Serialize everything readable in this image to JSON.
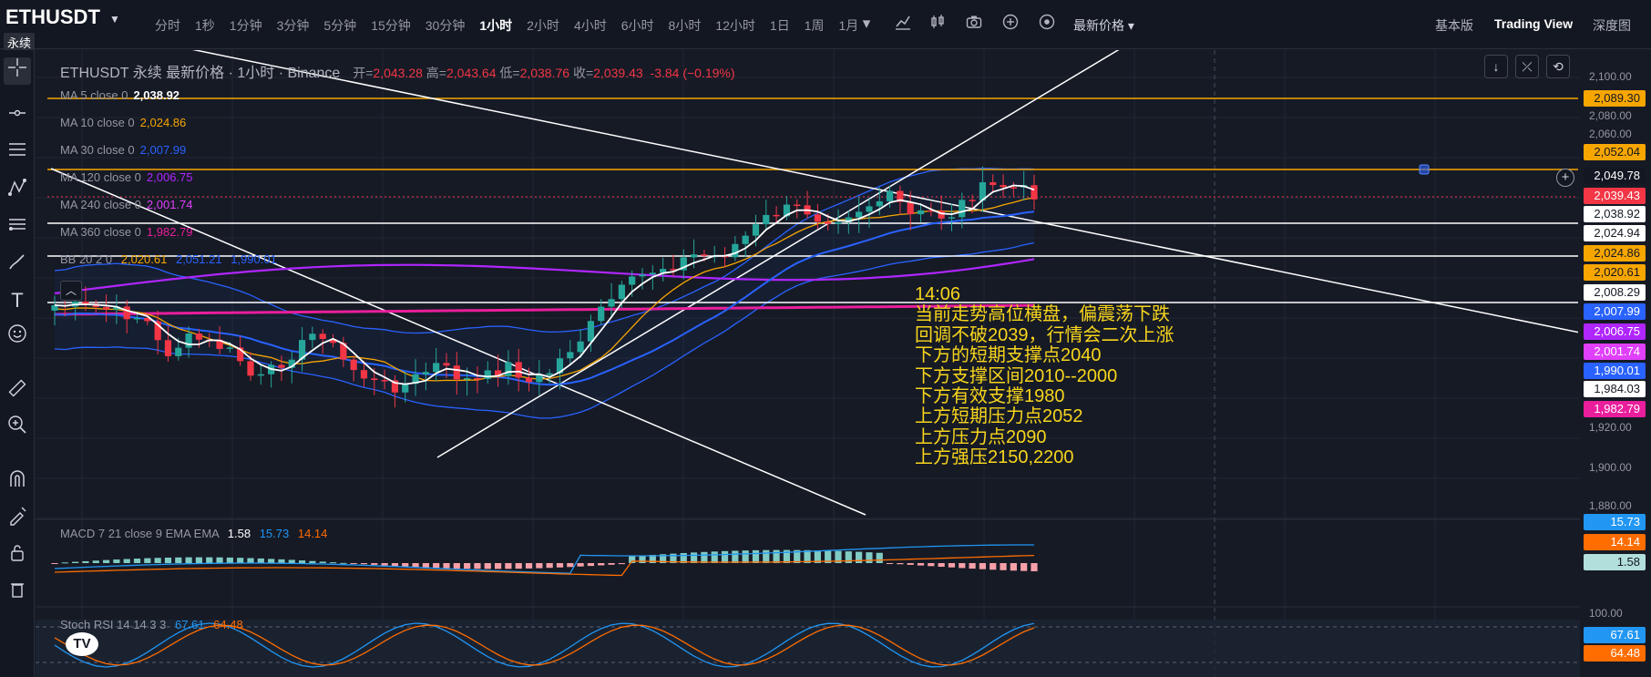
{
  "header": {
    "symbol": "ETHUSDT",
    "symbol_badge": "永续",
    "intervals": [
      "分时",
      "1秒",
      "1分钟",
      "3分钟",
      "5分钟",
      "15分钟",
      "30分钟",
      "1小时",
      "2小时",
      "4小时",
      "6小时",
      "8小时",
      "12小时",
      "1日",
      "1周",
      "1月"
    ],
    "active_interval": "1小时",
    "price_mode": "最新价格 ▾",
    "view_basic": "基本版",
    "view_tradingview": "Trading View",
    "view_depth": "深度图"
  },
  "legend": {
    "title": "ETHUSDT 永续 最新价格 · 1小时 · Binance",
    "open_label": "开=",
    "open": "2,043.28",
    "high_label": "高=",
    "high": "2,043.64",
    "low_label": "低=",
    "low": "2,038.76",
    "close_label": "收=",
    "close": "2,039.43",
    "change": "-3.84 (−0.19%)"
  },
  "indicators": [
    {
      "label": "MA 5 close 0",
      "value": "2,038.92",
      "color": "#ffffff"
    },
    {
      "label": "MA 10 close 0",
      "value": "2,024.86",
      "color": "#f7a600"
    },
    {
      "label": "MA 30 close 0",
      "value": "2,007.99",
      "color": "#2962ff"
    },
    {
      "label": "MA 120 close 0",
      "value": "2,006.75",
      "color": "#b026ff"
    },
    {
      "label": "MA 240 close 0",
      "value": "2,001.74",
      "color": "#e040fb"
    },
    {
      "label": "MA 360 close 0",
      "value": "1,982.79",
      "color": "#e91e9c"
    }
  ],
  "bb": {
    "label": "BB 20 2 0",
    "basis": "2,020.61",
    "upper": "2,051.21",
    "lower": "1,990.01"
  },
  "price_axis": {
    "ticks": [
      "2,100.00",
      "2,080.00",
      "2,060.00",
      "1,920.00",
      "1,900.00",
      "1,880.00"
    ],
    "labels": [
      {
        "text": "2,089.30",
        "bg": "#f7a600",
        "fg": "#131722"
      },
      {
        "text": "2,052.04",
        "bg": "#f7a600",
        "fg": "#131722"
      },
      {
        "text": "2,049.78",
        "bg": "#131722",
        "fg": "#ffffff"
      },
      {
        "text": "2,039.43",
        "bg": "#f23645",
        "fg": "#ffffff"
      },
      {
        "text": "2,038.92",
        "bg": "#ffffff",
        "fg": "#131722"
      },
      {
        "text": "2,024.94",
        "bg": "#ffffff",
        "fg": "#131722"
      },
      {
        "text": "2,024.86",
        "bg": "#f7a600",
        "fg": "#131722"
      },
      {
        "text": "2,020.61",
        "bg": "#f7a600",
        "fg": "#131722"
      },
      {
        "text": "2,008.29",
        "bg": "#ffffff",
        "fg": "#131722"
      },
      {
        "text": "2,007.99",
        "bg": "#2962ff",
        "fg": "#ffffff"
      },
      {
        "text": "2,006.75",
        "bg": "#b026ff",
        "fg": "#ffffff"
      },
      {
        "text": "2,001.74",
        "bg": "#e040fb",
        "fg": "#ffffff"
      },
      {
        "text": "1,990.01",
        "bg": "#2962ff",
        "fg": "#ffffff"
      },
      {
        "text": "1,984.03",
        "bg": "#ffffff",
        "fg": "#131722"
      },
      {
        "text": "1,982.79",
        "bg": "#e91e9c",
        "fg": "#ffffff"
      }
    ]
  },
  "note": {
    "lines": [
      "14:06",
      "当前走势高位横盘，偏震荡下跌",
      "回调不破2039，行情会二次上涨",
      "下方的短期支撑点2040",
      "下方支撑区间2010--2000",
      "下方有效支撑1980",
      "上方短期压力点2052",
      "上方压力点2090",
      "上方强压2150,2200"
    ]
  },
  "macd": {
    "label": "MACD 7 21 close 9 EMA EMA",
    "hist": "1.58",
    "macd": "15.73",
    "signal": "14.14",
    "axis": [
      {
        "text": "15.73",
        "bg": "#2196f3",
        "fg": "#ffffff"
      },
      {
        "text": "14.14",
        "bg": "#ff6d00",
        "fg": "#ffffff"
      },
      {
        "text": "1.58",
        "bg": "#b2dfdb",
        "fg": "#131722"
      }
    ]
  },
  "stoch": {
    "label": "Stoch RSI 14 14 3 3",
    "k": "67.61",
    "d": "64.48",
    "axis_tick": "100.00",
    "axis": [
      {
        "text": "67.61",
        "bg": "#2196f3",
        "fg": "#ffffff"
      },
      {
        "text": "64.48",
        "bg": "#ff6d00",
        "fg": "#ffffff"
      }
    ]
  },
  "logo": "TV"
}
